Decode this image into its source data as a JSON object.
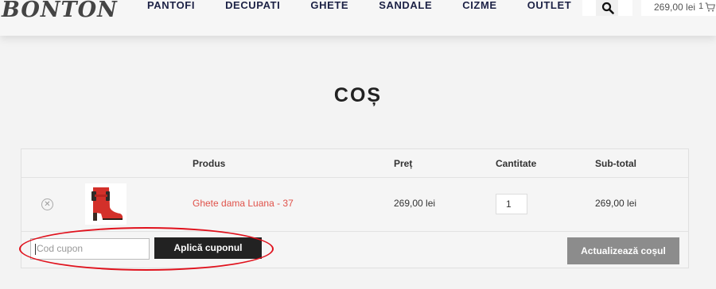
{
  "brand": {
    "logo_text": "BONTON"
  },
  "nav": {
    "items": [
      "PANTOFI",
      "DECUPATI",
      "GHETE",
      "SANDALE",
      "CIZME",
      "OUTLET"
    ]
  },
  "header": {
    "cart_total": "269,00 lei",
    "cart_count": "1"
  },
  "page": {
    "title": "COȘ"
  },
  "table": {
    "headers": {
      "product": "Produs",
      "price": "Preț",
      "quantity": "Cantitate",
      "subtotal": "Sub-total"
    },
    "row": {
      "product_name": "Ghete dama Luana - 37",
      "price": "269,00 lei",
      "quantity": "1",
      "subtotal": "269,00 lei"
    }
  },
  "coupon": {
    "placeholder": "Cod cupon",
    "apply_label": "Aplică cuponul"
  },
  "actions": {
    "update_label": "Actualizează coșul"
  },
  "colors": {
    "accent": "#e0524a",
    "dark_button": "#222222",
    "disabled_button": "#8c8c8c",
    "highlight": "#e0121d"
  }
}
